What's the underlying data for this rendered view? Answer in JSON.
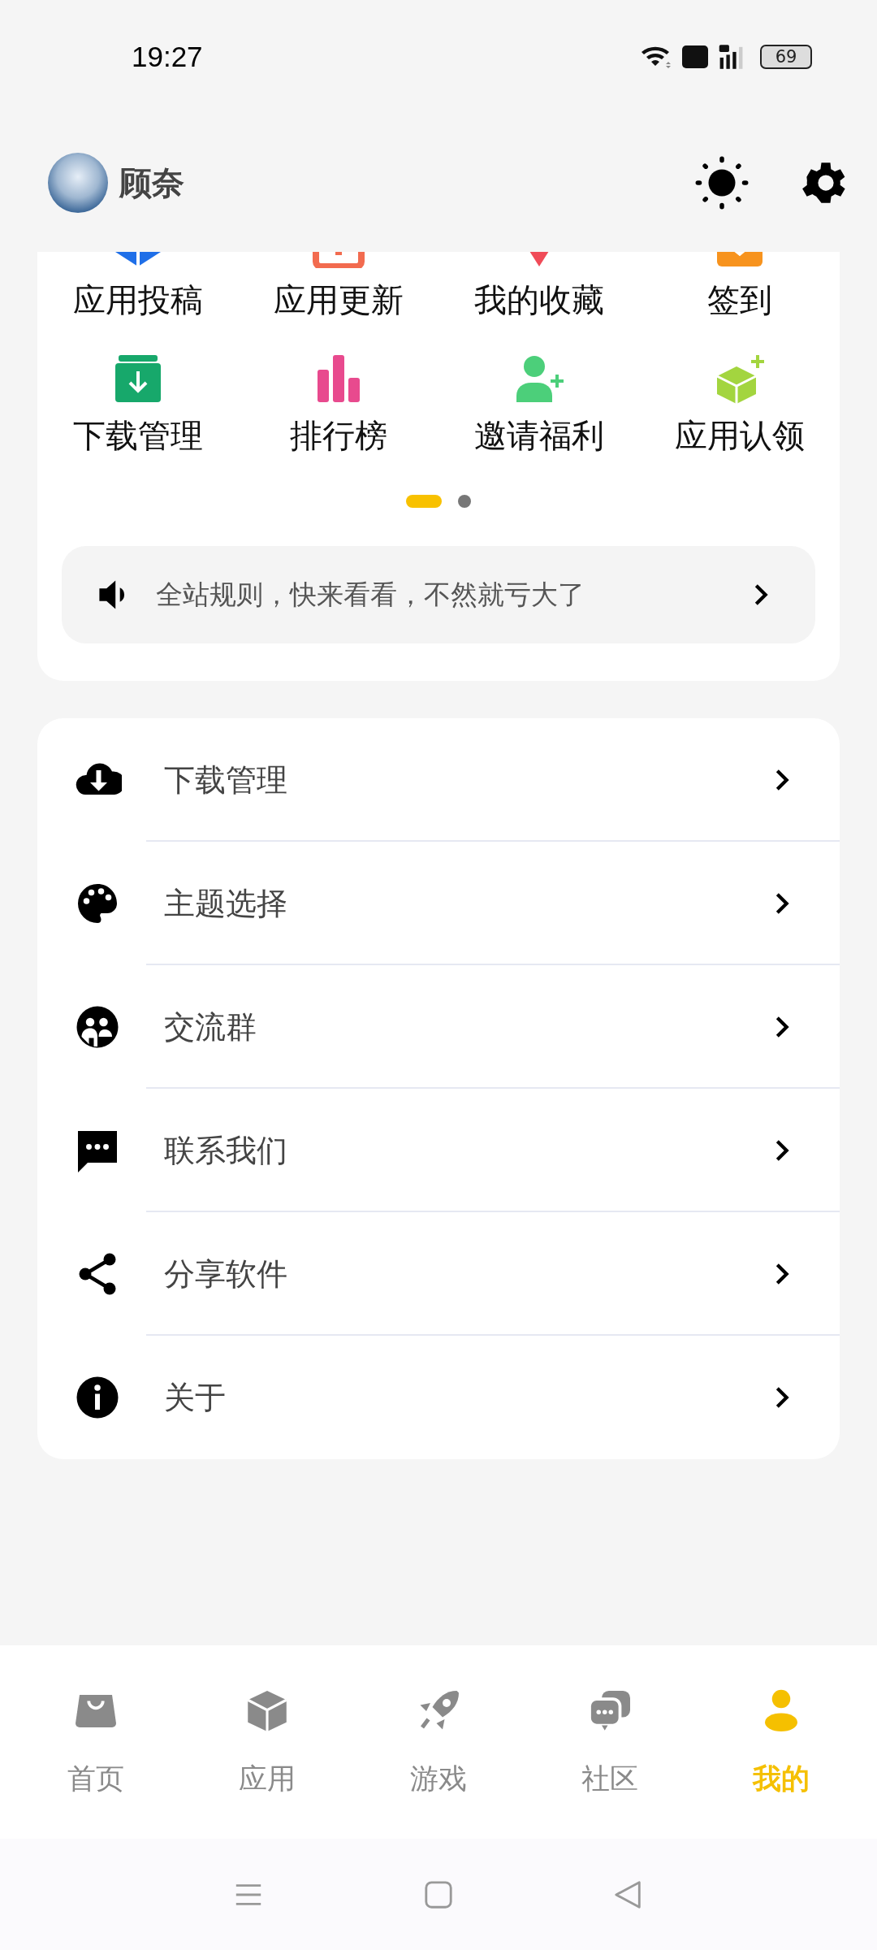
{
  "status_bar": {
    "time": "19:27",
    "battery": "69"
  },
  "header": {
    "username": "顾奈"
  },
  "shortcuts": [
    {
      "label": "应用投稿"
    },
    {
      "label": "应用更新"
    },
    {
      "label": "我的收藏"
    },
    {
      "label": "签到"
    },
    {
      "label": "下载管理"
    },
    {
      "label": "排行榜"
    },
    {
      "label": "邀请福利"
    },
    {
      "label": "应用认领"
    }
  ],
  "pager": [
    {
      "selected": true
    },
    {
      "selected": false
    }
  ],
  "notice": {
    "text": "全站规则，快来看看，不然就亏大了"
  },
  "menu": [
    {
      "label": "下载管理"
    },
    {
      "label": "主题选择"
    },
    {
      "label": "交流群"
    },
    {
      "label": "联系我们"
    },
    {
      "label": "分享软件"
    },
    {
      "label": "关于"
    }
  ],
  "tabs": [
    {
      "label": "首页",
      "selected": false
    },
    {
      "label": "应用",
      "selected": false
    },
    {
      "label": "游戏",
      "selected": false
    },
    {
      "label": "社区",
      "selected": false
    },
    {
      "label": "我的",
      "selected": true
    }
  ]
}
